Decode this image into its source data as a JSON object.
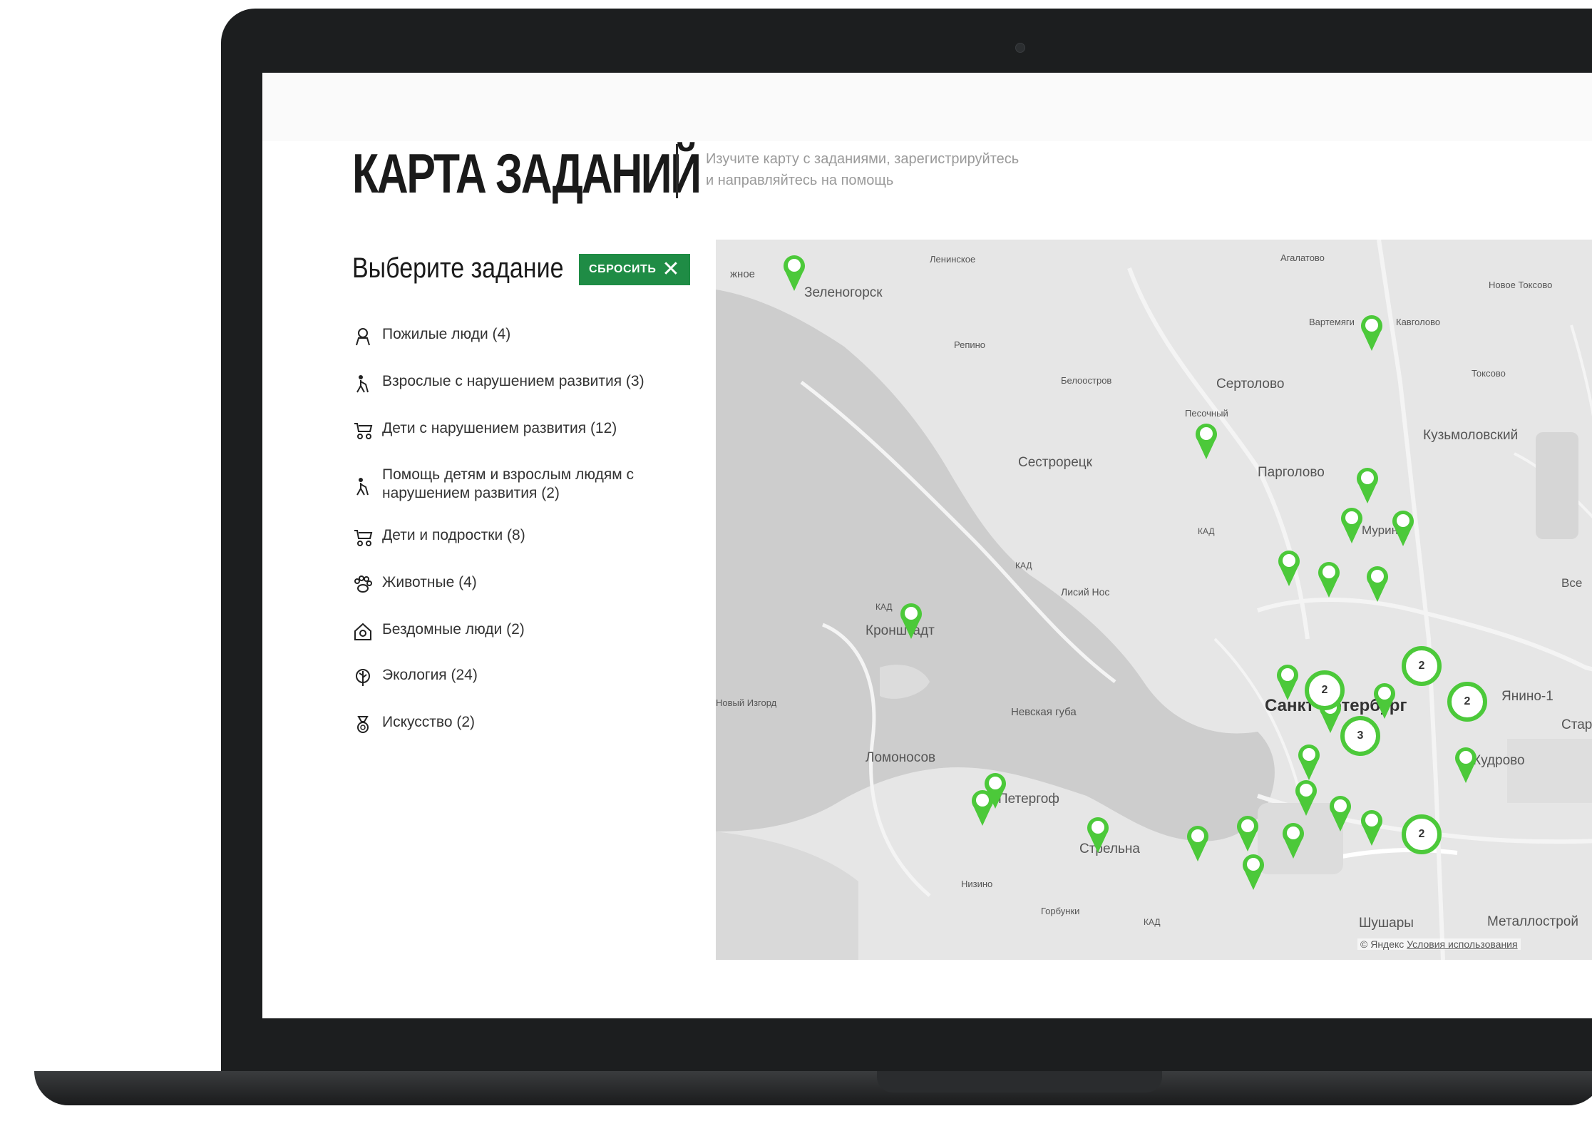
{
  "header": {
    "title": "КАРТА ЗАДАНИЙ",
    "subtitle_line1": "Изучите карту с заданиями, зарегистрируйтесь",
    "subtitle_line2": "и направляйтесь на помощь"
  },
  "sidebar": {
    "select_title": "Выберите задание",
    "reset_label": "СБРОСИТЬ",
    "categories": [
      {
        "label": "Пожилые люди (4)",
        "icon": "elderly-icon"
      },
      {
        "label": "Взрослые с нарушением развития (3)",
        "icon": "adult-disability-icon"
      },
      {
        "label": "Дети с нарушением развития (12)",
        "icon": "stroller-icon"
      },
      {
        "label": "Помощь детям и взрослым людям с нарушением развития (2)",
        "icon": "adult-disability-icon"
      },
      {
        "label": "Дети и подростки (8)",
        "icon": "stroller-icon"
      },
      {
        "label": "Животные (4)",
        "icon": "paw-icon"
      },
      {
        "label": "Бездомные люди (2)",
        "icon": "house-icon"
      },
      {
        "label": "Экология (24)",
        "icon": "leaf-icon"
      },
      {
        "label": "Искусство (2)",
        "icon": "medal-icon"
      }
    ]
  },
  "map": {
    "places": {
      "zelenogorsk": "Зеленогорск",
      "lenskoe": "Ленинское",
      "repino": "Репино",
      "beloostrov": "Белоостров",
      "sertolovo": "Сертолово",
      "pesochny": "Песочный",
      "sestroretsk": "Сестрорецк",
      "pargolovo": "Парголово",
      "murino": "Мурино",
      "kuzmolovsky": "Кузьмоловский",
      "agalatovo": "Агалатово",
      "vartemyagi": "Вартемяги",
      "kavgolovo": "Кавголово",
      "toksovo": "Токсово",
      "novoe_toksovo": "Новое Токсово",
      "kronstadt": "Кронштадт",
      "lisiy_nos": "Лисий Нос",
      "spb": "Санкт-Петербург",
      "yanino": "Янино-1",
      "kudrovo": "Кудрово",
      "nevskaya_guba": "Невская губа",
      "lomonosov": "Ломоносов",
      "peterhof": "Петергоф",
      "strelna": "Стрельна",
      "shushary": "Шушары",
      "metallostroy": "Металлострой",
      "zhnoe": "жное",
      "ust_izhora": "Новый Изгорд",
      "gorbunki": "Горбунки",
      "nizino": "Низино",
      "vsevolozhsk": "Все",
      "staraya": "Стар"
    },
    "road_label": "КАД",
    "clusters": [
      "2",
      "2",
      "2",
      "3",
      "2"
    ],
    "copyright": "© Яндекс",
    "terms": "Условия использования"
  },
  "colors": {
    "accent": "#1f8c45",
    "pin": "#4cc93a",
    "map_bg": "#e4e4e4",
    "water": "#cfcfcf"
  }
}
